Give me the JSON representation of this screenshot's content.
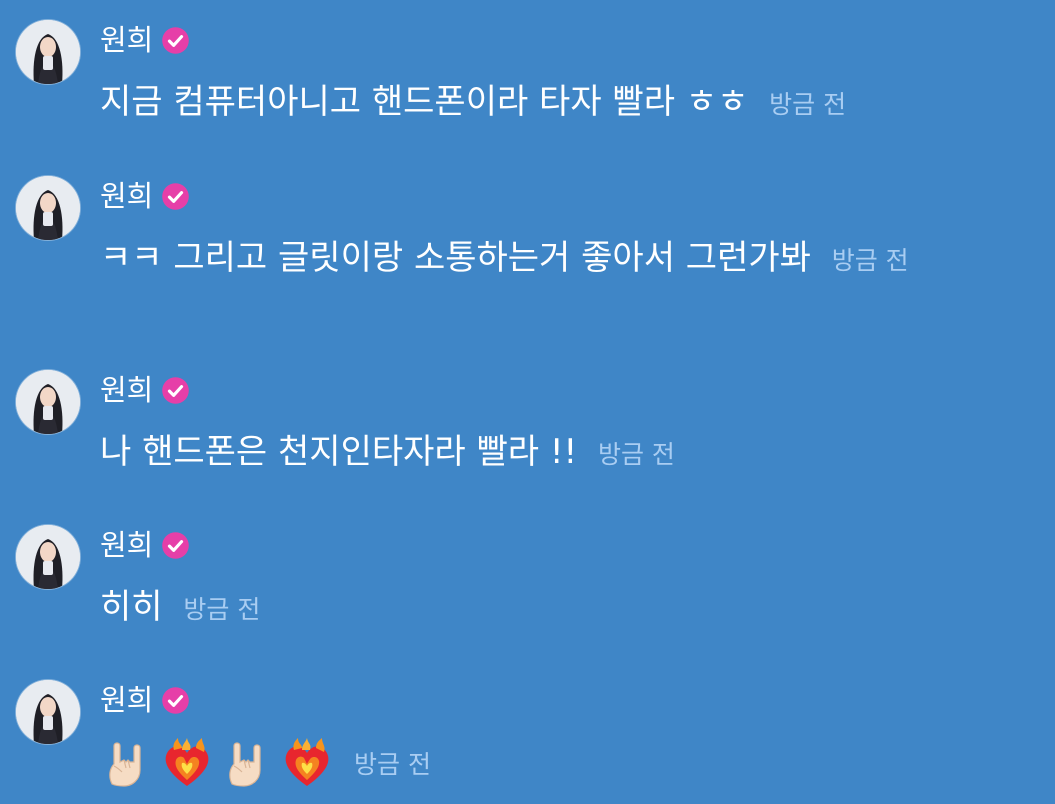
{
  "colors": {
    "background": "#3f86c7",
    "text": "#ffffff",
    "timestamp": "#a9cdf2",
    "verified_badge": "#e63fa8"
  },
  "icons": {
    "avatar": "avatar-photo",
    "verified": "verified-badge-icon",
    "rock_on": "sign-of-the-horns-emoji",
    "heart_on_fire": "heart-on-fire-emoji"
  },
  "messages": [
    {
      "sender": "원희",
      "text": "지금 컴퓨터아니고 핸드폰이라 타자 빨라 ㅎㅎ",
      "time": "방금 전"
    },
    {
      "sender": "원희",
      "text": "ㅋㅋ 그리고 글릿이랑 소통하는거 좋아서 그런가봐",
      "time": "방금 전"
    },
    {
      "sender": "원희",
      "text": "나 핸드폰은 천지인타자라 빨라 !!",
      "time": "방금 전"
    },
    {
      "sender": "원희",
      "text": "히히",
      "time": "방금 전"
    },
    {
      "sender": "원희",
      "emojis": [
        "sign-of-the-horns-emoji",
        "heart-on-fire-emoji",
        "sign-of-the-horns-emoji",
        "heart-on-fire-emoji"
      ],
      "time": "방금 전"
    }
  ]
}
